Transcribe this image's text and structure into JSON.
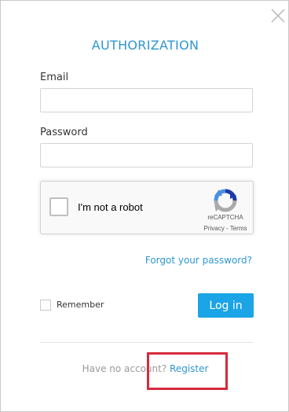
{
  "dialog": {
    "title": "AUTHORIZATION"
  },
  "icons": {
    "close": "close-icon",
    "recaptcha_logo": "recaptcha-logo-icon"
  },
  "form": {
    "email_label": "Email",
    "email_value": "",
    "password_label": "Password",
    "password_value": ""
  },
  "recaptcha": {
    "label": "I'm not a robot",
    "brand": "reCAPTCHA",
    "privacy": "Privacy",
    "separator": " - ",
    "terms": "Terms"
  },
  "links": {
    "forgot_password": "Forgot your password?"
  },
  "actions": {
    "remember_label": "Remember",
    "login_label": "Log in"
  },
  "footer": {
    "question": "Have no account? ",
    "register_label": "Register"
  },
  "colors": {
    "accent": "#2f97cf",
    "login_button": "#1ba4e6",
    "highlight": "#d62b3c"
  }
}
